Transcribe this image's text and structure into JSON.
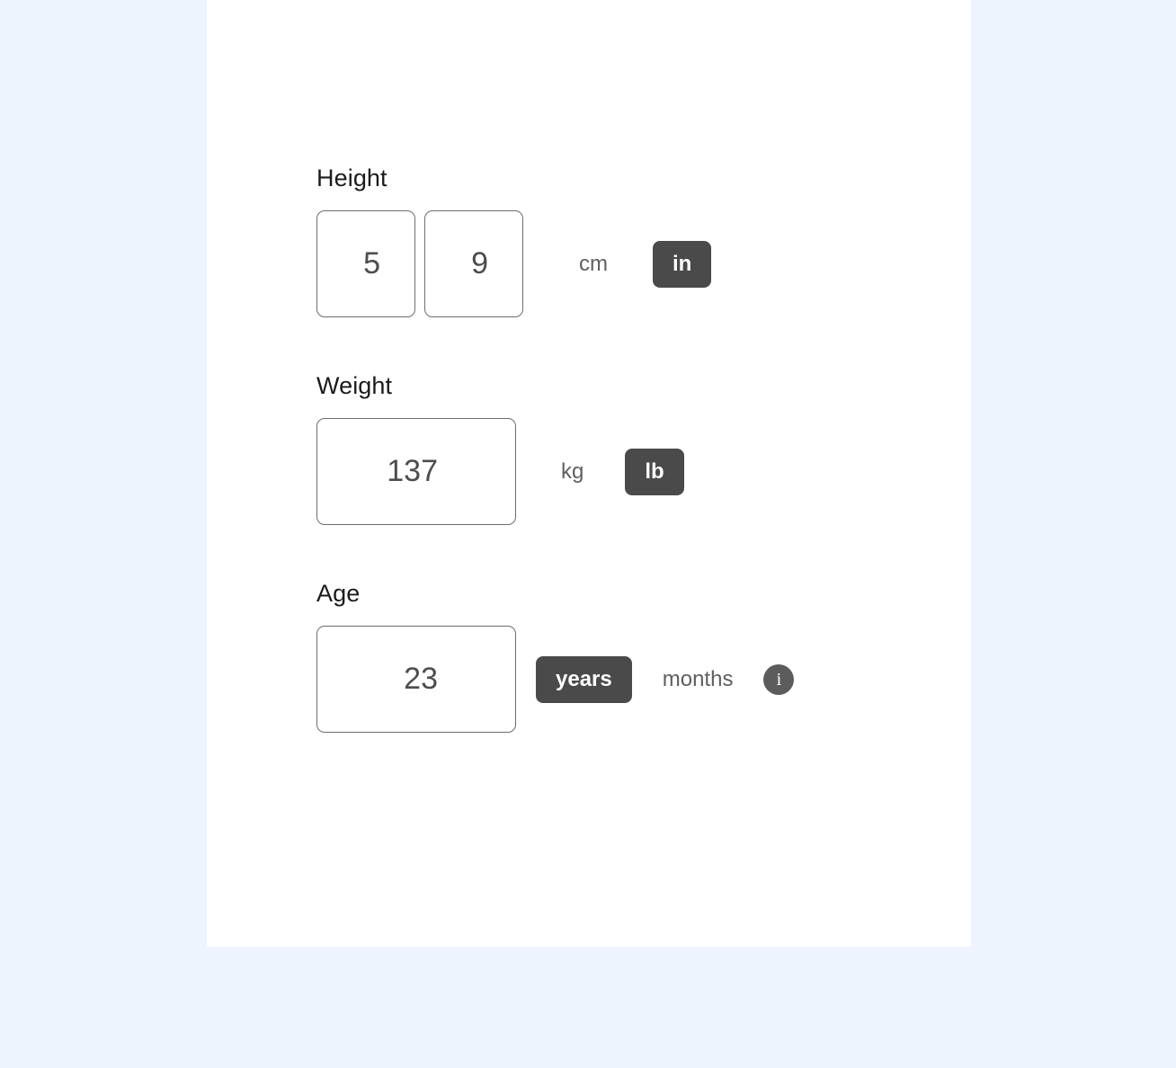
{
  "theme": {
    "page_background": "#edf4fe",
    "card_background": "#ffffff",
    "selected_toggle_background": "#4a4a4a",
    "selected_toggle_text": "#ffffff",
    "unselected_toggle_text": "#5f5f5f",
    "input_border": "#6d6d6d",
    "label_text": "#1b1b1b",
    "info_icon_background": "#5c5c5c"
  },
  "form": {
    "height": {
      "label": "Height",
      "feet_value": "5",
      "feet_placeholder": "",
      "inches_value": "9",
      "inches_placeholder": "",
      "units": [
        {
          "label": "cm",
          "selected": false
        },
        {
          "label": "in",
          "selected": true
        }
      ]
    },
    "weight": {
      "label": "Weight",
      "value": "137",
      "placeholder": "",
      "units": [
        {
          "label": "kg",
          "selected": false
        },
        {
          "label": "lb",
          "selected": true
        }
      ]
    },
    "age": {
      "label": "Age",
      "value": "23",
      "placeholder": "",
      "units": [
        {
          "label": "years",
          "selected": true
        },
        {
          "label": "months",
          "selected": false
        }
      ],
      "info_icon": "info-icon",
      "info_glyph": "i"
    }
  }
}
